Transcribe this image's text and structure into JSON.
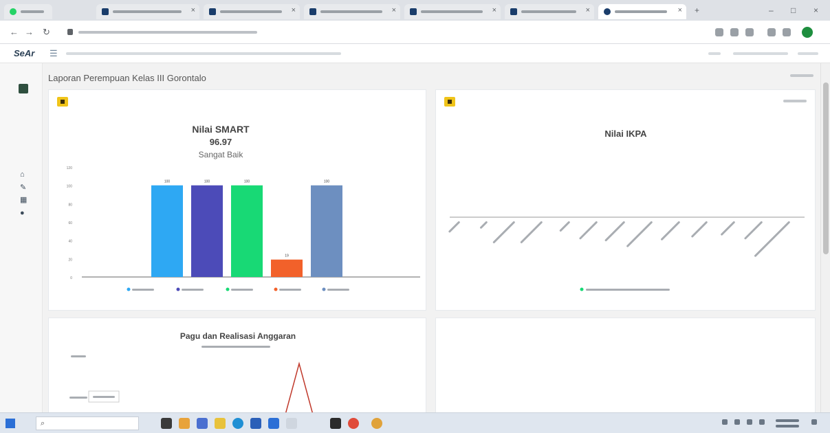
{
  "colors": {
    "bar_blue": "#2ea8f3",
    "bar_indigo": "#4c4bb8",
    "bar_green": "#18d975",
    "bar_orange": "#f2612a",
    "bar_slate": "#6d8fc0",
    "badge": "#f0c419",
    "line": "#c0392b"
  },
  "icons": {
    "brand": "",
    "menu": "menu-icon",
    "sidebar": [
      "home-icon",
      "edit-icon",
      "grid-icon",
      "chat-icon"
    ]
  },
  "app": {
    "brand_label": "SeAr",
    "page_title": "Laporan Perempuan Kelas III Gorontalo"
  },
  "chart_data": [
    {
      "type": "bar",
      "title": "Nilai SMART",
      "subtitle_value": "96.97",
      "subtitle_label": "Sangat Baik",
      "categories": [
        "",
        "",
        "",
        "",
        ""
      ],
      "values": [
        100,
        100,
        100,
        19,
        100
      ],
      "ylim": [
        0,
        120
      ],
      "yticks": [
        0,
        20,
        40,
        60,
        80,
        100,
        120
      ],
      "legend": [
        "",
        "",
        "",
        "",
        ""
      ],
      "legend_position": "bottom",
      "grid": false
    },
    {
      "type": "bar",
      "title": "Nilai IKPA",
      "categories": [
        "",
        "",
        "",
        "",
        "",
        "",
        "",
        "",
        "",
        "",
        "",
        "",
        ""
      ],
      "values": [],
      "legend": [
        ""
      ],
      "legend_position": "bottom",
      "grid": false
    },
    {
      "type": "line",
      "title": "Pagu dan Realisasi Anggaran",
      "subtitle": "",
      "ytick_labels": [
        "",
        ""
      ],
      "legend": [
        ""
      ],
      "grid": false
    }
  ]
}
